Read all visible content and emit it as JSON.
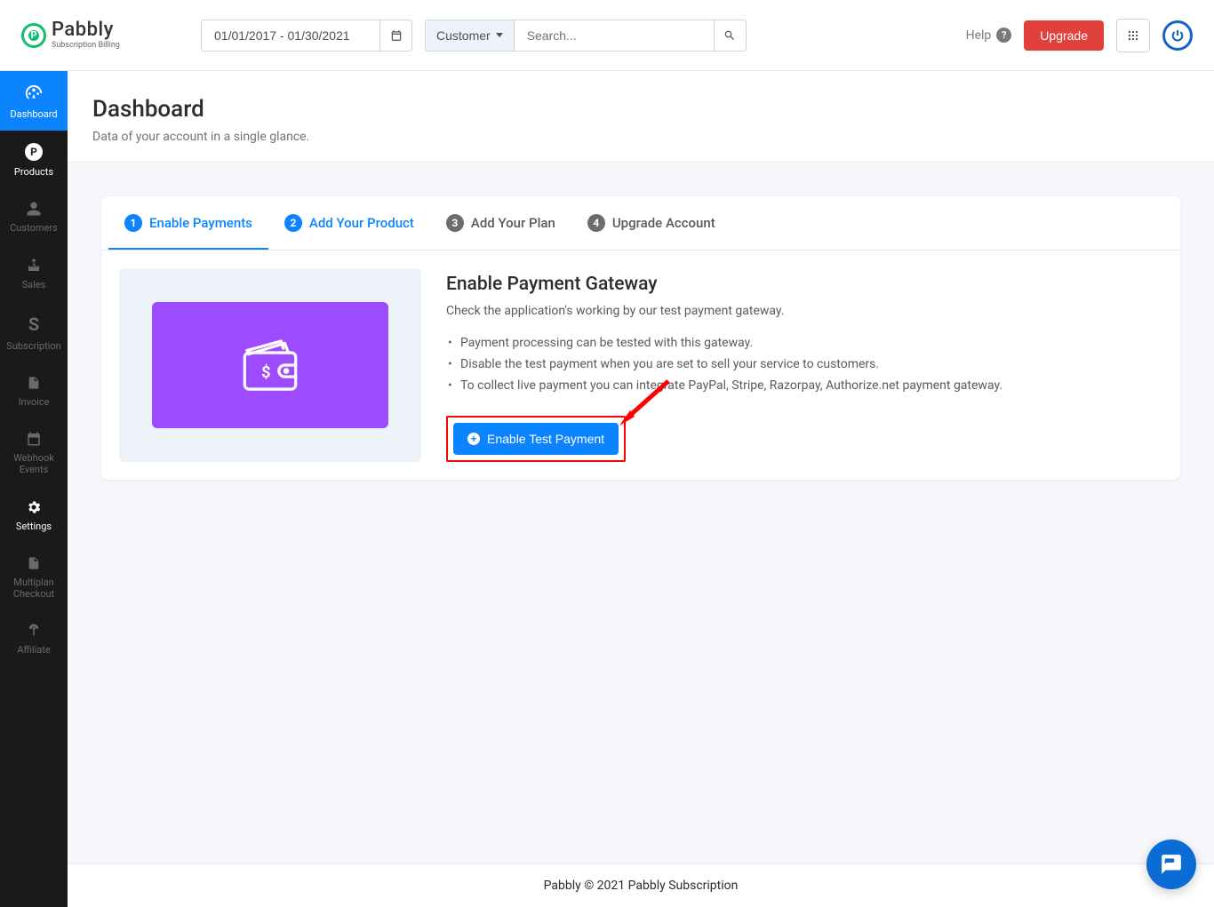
{
  "brand": {
    "name": "Pabbly",
    "tagline": "Subscription Billing"
  },
  "header": {
    "date_range": "01/01/2017 - 01/30/2021",
    "search_scope": "Customer",
    "search_placeholder": "Search...",
    "help_label": "Help",
    "upgrade_label": "Upgrade"
  },
  "sidebar": {
    "items": [
      {
        "label": "Dashboard"
      },
      {
        "label": "Products"
      },
      {
        "label": "Customers"
      },
      {
        "label": "Sales"
      },
      {
        "label": "Subscription"
      },
      {
        "label": "Invoice"
      },
      {
        "label": "Webhook Events"
      },
      {
        "label": "Settings"
      },
      {
        "label": "Multiplan Checkout"
      },
      {
        "label": "Affiliate"
      }
    ]
  },
  "page": {
    "title": "Dashboard",
    "subtitle": "Data of your account in a single glance."
  },
  "steps": [
    {
      "num": "1",
      "label": "Enable Payments"
    },
    {
      "num": "2",
      "label": "Add Your Product"
    },
    {
      "num": "3",
      "label": "Add Your Plan"
    },
    {
      "num": "4",
      "label": "Upgrade Account"
    }
  ],
  "gateway": {
    "title": "Enable Payment Gateway",
    "description": "Check the application's working by our test payment gateway.",
    "bullets": [
      "Payment processing can be tested with this gateway.",
      "Disable the test payment when you are set to sell your service to customers.",
      "To collect live payment you can integrate PayPal, Stripe, Razorpay, Authorize.net payment gateway."
    ],
    "cta_label": "Enable Test Payment"
  },
  "footer": {
    "text": "Pabbly © 2021 Pabbly Subscription"
  },
  "colors": {
    "primary": "#0c84ff",
    "danger": "#e2403d",
    "accent": "#9e4bff",
    "brand_green": "#0dbf6e"
  }
}
